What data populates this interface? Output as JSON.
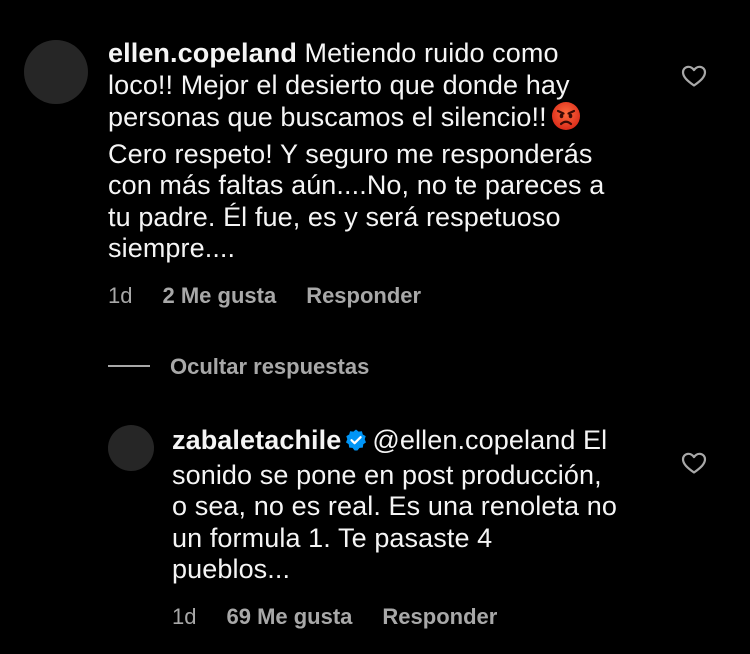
{
  "colors": {
    "background": "#000000",
    "text": "#f5f5f5",
    "muted": "#a8a8a8",
    "avatar": "#262626",
    "verified": "#0095f6"
  },
  "comment": {
    "username": "ellen.copeland",
    "text_lines": [
      " Metiendo ruido como",
      "loco!! Mejor el desierto que donde hay",
      "personas que buscamos el silencio!!",
      "Cero respeto! Y seguro me responderás",
      "con más faltas aún....No, no te pareces a",
      "tu padre. Él fue, es y será respetuoso",
      "siempre...."
    ],
    "emoji_icon": "pouting-face-emoji",
    "time": "1d",
    "likes": "2 Me gusta",
    "reply_label": "Responder",
    "heart_icon": "heart-outline-icon"
  },
  "hide_replies_label": "Ocultar respuestas",
  "reply": {
    "username": "zabaletachile",
    "verified_icon": "verified-badge-icon",
    "text_first": "@ellen.copeland El",
    "text_lines": [
      "sonido se pone en post producción,",
      "o sea, no es real. Es una renoleta no",
      "un formula 1.  Te pasaste 4",
      "pueblos..."
    ],
    "time": "1d",
    "likes": "69 Me gusta",
    "reply_label": "Responder",
    "heart_icon": "heart-outline-icon"
  }
}
